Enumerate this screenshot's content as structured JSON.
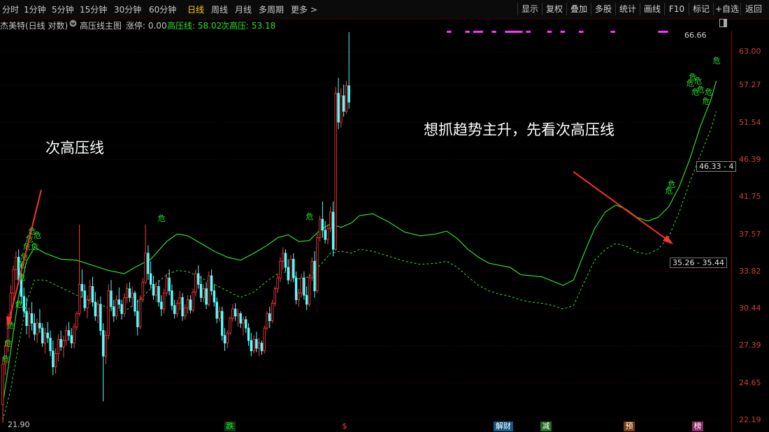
{
  "toolbar": {
    "timeframes": [
      "分时",
      "1分钟",
      "5分钟",
      "15分钟",
      "30分钟",
      "60分钟",
      "日线",
      "周线",
      "月线",
      "多周期",
      "更多 >"
    ],
    "active_timeframe": "日线",
    "buttons": [
      "显示",
      "复权",
      "叠加",
      "多股",
      "统计",
      "画线",
      "F10",
      "标记",
      "+自选",
      "返回"
    ]
  },
  "info": {
    "stock": "杰美特(日线 对数)",
    "indicator": "高压线主图",
    "zhangting": "涨停: 0.00",
    "high_line": "高压线: 58.02",
    "second_high_line": "次高压: 53.18"
  },
  "annotations": {
    "left": "次高压线",
    "right": "想抓趋势主升，先看次高压线"
  },
  "price_labels": {
    "top": "66.66",
    "low": "21.90",
    "box1": "46.33 - 4",
    "box2": "35.26 - 35.44"
  },
  "events": [
    {
      "label": "跌",
      "color": "#2ae22a",
      "bg": "#0f3a0f"
    },
    {
      "label": "$",
      "color": "#ff4040",
      "bg": "#000000"
    },
    {
      "label": "解财",
      "color": "#ffffff",
      "bg": "#135a82"
    },
    {
      "label": "减",
      "color": "#ffffff",
      "bg": "#1f6a1f"
    },
    {
      "label": "预",
      "color": "#ffffff",
      "bg": "#7a3a0f"
    },
    {
      "label": "榜",
      "color": "#ffffff",
      "bg": "#8a2a6a"
    }
  ],
  "colors": {
    "up": "#ff3c3c",
    "down": "#54ffff",
    "high_line": "#2ae22a",
    "second_line": "#2ae22a",
    "axis": "#d23c3c",
    "arrow": "#ff3030",
    "magenta": "#ff33ff"
  },
  "chart_data": {
    "type": "candlestick",
    "title": "",
    "y_scale": "log",
    "ylim": [
      22.19,
      66.66
    ],
    "y_ticks": [
      63.0,
      57.27,
      51.54,
      46.39,
      41.75,
      37.57,
      33.82,
      30.44,
      27.39,
      24.65,
      22.19
    ],
    "candles": [
      [
        23.2,
        26.5,
        22.0,
        26.0
      ],
      [
        26.0,
        27.8,
        25.2,
        27.4
      ],
      [
        27.4,
        30.0,
        26.9,
        29.7
      ],
      [
        29.7,
        32.5,
        29.0,
        31.8
      ],
      [
        31.8,
        34.4,
        31.0,
        34.0
      ],
      [
        34.0,
        35.8,
        33.0,
        35.2
      ],
      [
        35.2,
        36.0,
        32.6,
        33.0
      ],
      [
        33.0,
        34.6,
        30.8,
        31.5
      ],
      [
        31.5,
        32.3,
        29.7,
        30.2
      ],
      [
        30.2,
        31.4,
        28.3,
        29.0
      ],
      [
        29.0,
        30.5,
        28.0,
        30.0
      ],
      [
        30.0,
        31.0,
        28.6,
        29.2
      ],
      [
        29.2,
        30.0,
        27.8,
        28.3
      ],
      [
        28.3,
        29.6,
        27.6,
        29.2
      ],
      [
        29.2,
        30.4,
        28.4,
        28.8
      ],
      [
        28.8,
        29.2,
        27.3,
        27.6
      ],
      [
        27.6,
        28.8,
        26.8,
        28.4
      ],
      [
        28.4,
        29.3,
        27.6,
        28.0
      ],
      [
        28.0,
        28.6,
        26.6,
        27.0
      ],
      [
        27.0,
        27.8,
        25.2,
        25.8
      ],
      [
        25.8,
        27.2,
        25.3,
        26.8
      ],
      [
        26.8,
        28.3,
        26.2,
        27.9
      ],
      [
        27.9,
        28.6,
        27.0,
        27.3
      ],
      [
        27.3,
        28.2,
        26.5,
        27.8
      ],
      [
        27.8,
        29.0,
        27.4,
        28.6
      ],
      [
        28.6,
        29.3,
        27.8,
        28.2
      ],
      [
        28.2,
        28.8,
        27.2,
        27.6
      ],
      [
        27.6,
        29.2,
        27.2,
        28.9
      ],
      [
        28.9,
        30.2,
        28.6,
        30.0
      ],
      [
        30.0,
        38.6,
        29.8,
        32.6
      ],
      [
        32.6,
        34.0,
        31.4,
        32.0
      ],
      [
        32.0,
        32.6,
        30.2,
        30.5
      ],
      [
        30.5,
        31.6,
        29.6,
        31.2
      ],
      [
        31.2,
        33.0,
        30.8,
        32.4
      ],
      [
        32.4,
        33.3,
        30.6,
        31.0
      ],
      [
        31.0,
        31.9,
        29.4,
        29.8
      ],
      [
        29.8,
        31.2,
        29.2,
        30.8
      ],
      [
        30.8,
        31.5,
        28.2,
        28.6
      ],
      [
        28.6,
        29.2,
        23.4,
        26.6
      ],
      [
        26.6,
        28.6,
        26.0,
        28.2
      ],
      [
        28.2,
        32.6,
        27.9,
        32.0
      ],
      [
        32.0,
        33.0,
        30.2,
        30.6
      ],
      [
        30.6,
        31.2,
        29.3,
        29.8
      ],
      [
        29.8,
        31.6,
        29.5,
        31.2
      ],
      [
        31.2,
        32.3,
        30.4,
        30.8
      ],
      [
        30.8,
        31.2,
        29.5,
        30.0
      ],
      [
        30.0,
        31.8,
        29.7,
        31.4
      ],
      [
        31.4,
        32.7,
        30.9,
        32.2
      ],
      [
        32.2,
        32.8,
        31.0,
        31.4
      ],
      [
        31.4,
        32.4,
        30.6,
        31.8
      ],
      [
        31.8,
        32.0,
        29.8,
        30.2
      ],
      [
        30.2,
        31.2,
        28.2,
        28.9
      ],
      [
        28.9,
        31.6,
        28.7,
        31.2
      ],
      [
        31.2,
        33.2,
        31.0,
        32.8
      ],
      [
        32.8,
        38.6,
        32.6,
        35.6
      ],
      [
        35.6,
        36.4,
        33.0,
        33.6
      ],
      [
        33.6,
        34.8,
        32.2,
        32.6
      ],
      [
        32.6,
        33.4,
        31.2,
        31.6
      ],
      [
        31.6,
        32.8,
        31.0,
        32.4
      ],
      [
        32.4,
        33.0,
        30.6,
        31.0
      ],
      [
        31.0,
        31.6,
        29.8,
        30.4
      ],
      [
        30.4,
        32.2,
        30.0,
        31.8
      ],
      [
        31.8,
        33.6,
        31.5,
        33.2
      ],
      [
        33.2,
        34.0,
        31.6,
        32.0
      ],
      [
        32.0,
        32.6,
        30.3,
        30.7
      ],
      [
        30.7,
        31.2,
        29.6,
        30.0
      ],
      [
        30.0,
        31.2,
        29.7,
        30.9
      ],
      [
        30.9,
        32.0,
        30.3,
        31.4
      ],
      [
        31.4,
        31.8,
        29.4,
        29.8
      ],
      [
        29.8,
        30.8,
        29.5,
        30.5
      ],
      [
        30.5,
        31.6,
        30.0,
        31.2
      ],
      [
        31.2,
        31.6,
        30.0,
        30.3
      ],
      [
        30.3,
        32.2,
        30.1,
        31.9
      ],
      [
        31.9,
        34.0,
        31.5,
        33.6
      ],
      [
        33.6,
        34.4,
        32.2,
        32.6
      ],
      [
        32.6,
        33.4,
        31.0,
        31.4
      ],
      [
        31.4,
        32.6,
        31.0,
        32.2
      ],
      [
        32.2,
        32.8,
        30.4,
        30.8
      ],
      [
        30.8,
        33.8,
        30.6,
        33.4
      ],
      [
        33.4,
        34.0,
        31.6,
        32.0
      ],
      [
        32.0,
        32.6,
        30.6,
        31.0
      ],
      [
        31.0,
        31.4,
        29.2,
        29.6
      ],
      [
        29.6,
        30.6,
        29.3,
        30.2
      ],
      [
        30.2,
        30.6,
        27.8,
        28.2
      ],
      [
        28.2,
        28.8,
        27.0,
        27.6
      ],
      [
        27.6,
        28.6,
        27.2,
        28.4
      ],
      [
        28.4,
        29.8,
        28.2,
        29.6
      ],
      [
        29.6,
        30.8,
        29.3,
        30.4
      ],
      [
        30.4,
        30.9,
        29.4,
        29.8
      ],
      [
        29.8,
        30.4,
        28.9,
        30.0
      ],
      [
        30.0,
        30.2,
        28.8,
        29.2
      ],
      [
        29.2,
        29.8,
        28.2,
        29.5
      ],
      [
        29.5,
        29.8,
        28.4,
        28.8
      ],
      [
        28.8,
        29.2,
        27.4,
        27.8
      ],
      [
        27.8,
        28.4,
        26.6,
        27.0
      ],
      [
        27.0,
        28.2,
        26.8,
        27.9
      ],
      [
        27.9,
        28.5,
        26.9,
        27.2
      ],
      [
        27.2,
        28.0,
        26.6,
        27.6
      ],
      [
        27.6,
        27.8,
        26.7,
        27.0
      ],
      [
        27.0,
        29.0,
        26.8,
        28.8
      ],
      [
        28.8,
        30.2,
        28.6,
        30.0
      ],
      [
        30.0,
        30.6,
        28.8,
        29.4
      ],
      [
        29.4,
        31.2,
        29.2,
        30.9
      ],
      [
        30.9,
        32.4,
        30.6,
        32.2
      ],
      [
        32.2,
        33.6,
        31.8,
        33.2
      ],
      [
        33.2,
        35.2,
        32.8,
        34.8
      ],
      [
        34.8,
        36.2,
        34.0,
        35.6
      ],
      [
        35.6,
        36.0,
        33.8,
        34.2
      ],
      [
        34.2,
        35.0,
        32.6,
        33.0
      ],
      [
        33.0,
        35.4,
        32.8,
        35.0
      ],
      [
        35.0,
        35.6,
        32.8,
        33.2
      ],
      [
        33.2,
        33.8,
        30.8,
        31.2
      ],
      [
        31.2,
        32.2,
        30.6,
        31.8
      ],
      [
        31.8,
        33.6,
        31.4,
        33.2
      ],
      [
        33.2,
        33.8,
        31.2,
        31.6
      ],
      [
        31.6,
        32.4,
        30.3,
        30.8
      ],
      [
        30.8,
        33.6,
        30.6,
        33.2
      ],
      [
        33.2,
        35.2,
        32.9,
        34.8
      ],
      [
        34.8,
        35.8,
        31.4,
        32.0
      ],
      [
        32.0,
        37.6,
        31.8,
        37.2
      ],
      [
        37.2,
        39.6,
        36.8,
        39.2
      ],
      [
        39.2,
        41.2,
        37.2,
        38.0
      ],
      [
        38.0,
        39.0,
        36.6,
        37.0
      ],
      [
        37.0,
        38.6,
        36.5,
        38.2
      ],
      [
        38.2,
        40.6,
        37.8,
        40.0
      ],
      [
        40.0,
        41.2,
        35.3,
        36.0
      ],
      [
        36.0,
        57.0,
        35.8,
        56.0
      ],
      [
        56.0,
        58.5,
        50.6,
        51.6
      ],
      [
        51.6,
        56.8,
        50.8,
        55.6
      ],
      [
        55.6,
        57.4,
        52.4,
        53.2
      ],
      [
        53.2,
        58.0,
        52.8,
        57.2
      ],
      [
        57.2,
        66.6,
        53.6,
        54.6
      ]
    ],
    "high_line": [
      [
        0,
        23.2
      ],
      [
        3,
        27.0
      ],
      [
        6,
        31.5
      ],
      [
        9,
        34.8
      ],
      [
        12,
        36.2
      ],
      [
        16,
        35.6
      ],
      [
        22,
        35.0
      ],
      [
        28,
        34.9
      ],
      [
        34,
        34.4
      ],
      [
        40,
        33.9
      ],
      [
        46,
        33.6
      ],
      [
        50,
        34.2
      ],
      [
        56,
        35.0
      ],
      [
        62,
        36.8
      ],
      [
        66,
        37.6
      ],
      [
        70,
        37.4
      ],
      [
        75,
        36.6
      ],
      [
        80,
        35.8
      ],
      [
        85,
        35.2
      ],
      [
        90,
        34.9
      ],
      [
        95,
        35.6
      ],
      [
        100,
        36.4
      ],
      [
        104,
        37.2
      ],
      [
        108,
        37.5
      ],
      [
        112,
        36.8
      ],
      [
        116,
        36.9
      ],
      [
        120,
        38.0
      ],
      [
        124,
        38.7
      ],
      [
        128,
        38.3
      ],
      [
        132,
        38.8
      ],
      [
        135,
        39.6
      ],
      [
        140,
        39.8
      ],
      [
        146,
        38.9
      ],
      [
        152,
        37.8
      ],
      [
        158,
        37.4
      ],
      [
        164,
        37.6
      ],
      [
        168,
        37.9
      ],
      [
        172,
        37.1
      ],
      [
        176,
        36.0
      ],
      [
        180,
        35.2
      ],
      [
        184,
        34.6
      ],
      [
        188,
        34.4
      ],
      [
        192,
        34.2
      ],
      [
        196,
        33.5
      ],
      [
        200,
        33.4
      ],
      [
        204,
        33.3
      ],
      [
        208,
        32.9
      ],
      [
        212,
        32.5
      ],
      [
        216,
        33.0
      ],
      [
        220,
        35.6
      ],
      [
        224,
        38.2
      ],
      [
        228,
        40.0
      ],
      [
        232,
        40.8
      ],
      [
        236,
        40.3
      ],
      [
        240,
        39.4
      ],
      [
        244,
        39.0
      ],
      [
        248,
        39.4
      ],
      [
        252,
        40.6
      ],
      [
        256,
        43.0
      ],
      [
        260,
        46.5
      ],
      [
        264,
        51.0
      ],
      [
        268,
        55.0
      ],
      [
        270,
        58.0
      ]
    ],
    "second_high_line": [
      [
        0,
        22.2
      ],
      [
        3,
        24.2
      ],
      [
        6,
        27.5
      ],
      [
        9,
        31.0
      ],
      [
        12,
        33.0
      ],
      [
        16,
        33.0
      ],
      [
        22,
        32.3
      ],
      [
        28,
        31.6
      ],
      [
        34,
        31.0
      ],
      [
        40,
        30.5
      ],
      [
        46,
        30.2
      ],
      [
        50,
        30.8
      ],
      [
        56,
        32.2
      ],
      [
        62,
        33.5
      ],
      [
        66,
        33.9
      ],
      [
        70,
        33.8
      ],
      [
        75,
        33.2
      ],
      [
        80,
        32.6
      ],
      [
        85,
        32.0
      ],
      [
        90,
        31.4
      ],
      [
        95,
        31.9
      ],
      [
        100,
        32.9
      ],
      [
        104,
        33.6
      ],
      [
        108,
        33.8
      ],
      [
        112,
        33.1
      ],
      [
        116,
        33.3
      ],
      [
        120,
        34.4
      ],
      [
        124,
        35.6
      ],
      [
        128,
        35.8
      ],
      [
        132,
        35.6
      ],
      [
        135,
        36.0
      ],
      [
        140,
        35.8
      ],
      [
        146,
        35.3
      ],
      [
        152,
        34.8
      ],
      [
        158,
        34.5
      ],
      [
        164,
        34.6
      ],
      [
        168,
        34.8
      ],
      [
        172,
        34.2
      ],
      [
        176,
        33.3
      ],
      [
        180,
        32.5
      ],
      [
        184,
        32.0
      ],
      [
        188,
        31.7
      ],
      [
        192,
        31.5
      ],
      [
        196,
        31.2
      ],
      [
        200,
        31.0
      ],
      [
        204,
        30.9
      ],
      [
        208,
        30.7
      ],
      [
        212,
        30.4
      ],
      [
        216,
        30.7
      ],
      [
        220,
        32.8
      ],
      [
        224,
        34.9
      ],
      [
        228,
        36.0
      ],
      [
        232,
        36.6
      ],
      [
        236,
        36.3
      ],
      [
        240,
        35.7
      ],
      [
        244,
        35.5
      ],
      [
        248,
        36.0
      ],
      [
        252,
        37.3
      ],
      [
        256,
        40.0
      ],
      [
        260,
        43.6
      ],
      [
        264,
        47.0
      ],
      [
        268,
        50.6
      ],
      [
        270,
        53.2
      ]
    ],
    "danger_marks": [
      [
        1,
        26.2
      ],
      [
        2,
        27.4
      ],
      [
        3,
        28.8
      ],
      [
        6,
        30.6
      ],
      [
        7,
        33.0
      ],
      [
        7,
        34.2
      ],
      [
        8,
        35.0
      ],
      [
        9,
        36.0
      ],
      [
        10,
        36.8
      ],
      [
        11,
        37.6
      ],
      [
        12,
        36.0
      ],
      [
        13,
        37.2
      ],
      [
        60,
        39.0
      ],
      [
        116,
        39.2
      ],
      [
        252,
        42.2
      ],
      [
        253,
        43.0
      ],
      [
        260,
        57.2
      ],
      [
        261,
        58.2
      ],
      [
        262,
        55.8
      ],
      [
        263,
        57.6
      ],
      [
        264,
        56.2
      ],
      [
        266,
        54.4
      ],
      [
        267,
        55.8
      ],
      [
        270,
        61.0
      ]
    ],
    "magenta_top": [
      [
        168,
        169
      ],
      [
        175,
        176
      ],
      [
        178,
        181
      ],
      [
        185,
        186
      ],
      [
        190,
        196
      ],
      [
        198,
        199
      ],
      [
        206,
        207
      ],
      [
        211,
        212
      ],
      [
        218,
        219
      ],
      [
        230,
        231
      ],
      [
        248,
        251
      ]
    ]
  }
}
